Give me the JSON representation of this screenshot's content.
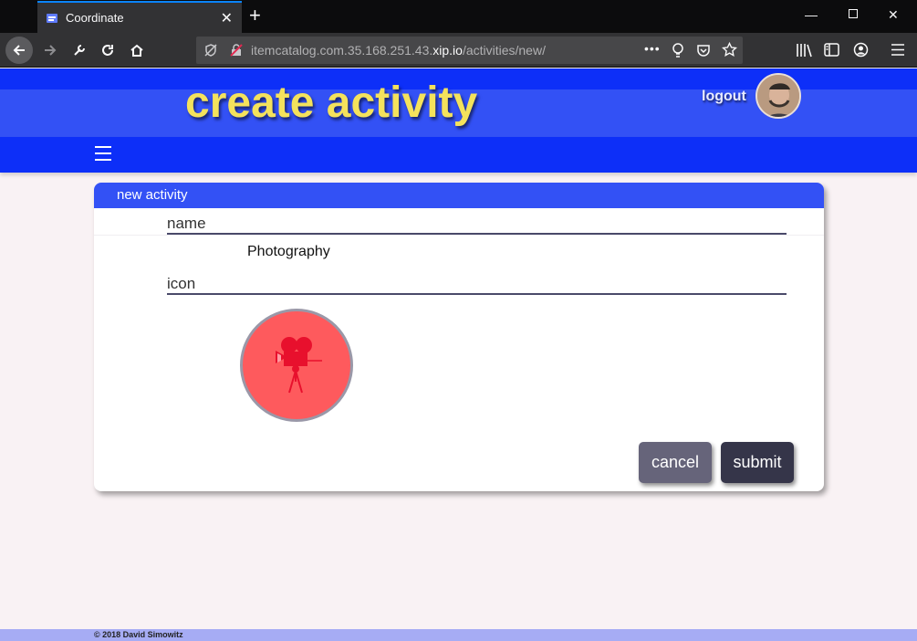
{
  "browser": {
    "tab_title": "Coordinate",
    "url_prefix": "itemcatalog.com.35.168.251.43.",
    "url_host": "xip.io",
    "url_path": "/activities/new/"
  },
  "header": {
    "title": "create activity",
    "logout_label": "logout"
  },
  "card": {
    "title": "new activity",
    "name_label": "name",
    "name_value": "Photography",
    "icon_label": "icon",
    "icon_name": "movie-camera-icon"
  },
  "buttons": {
    "cancel_label": "cancel",
    "submit_label": "submit"
  },
  "footer": {
    "copyright": "© 2018 David Simowitz"
  },
  "colors": {
    "header_blue": "#3351f5",
    "title_yellow": "#f4e25c",
    "icon_circle": "#fe5a5d",
    "icon_glyph": "#e8102d"
  }
}
